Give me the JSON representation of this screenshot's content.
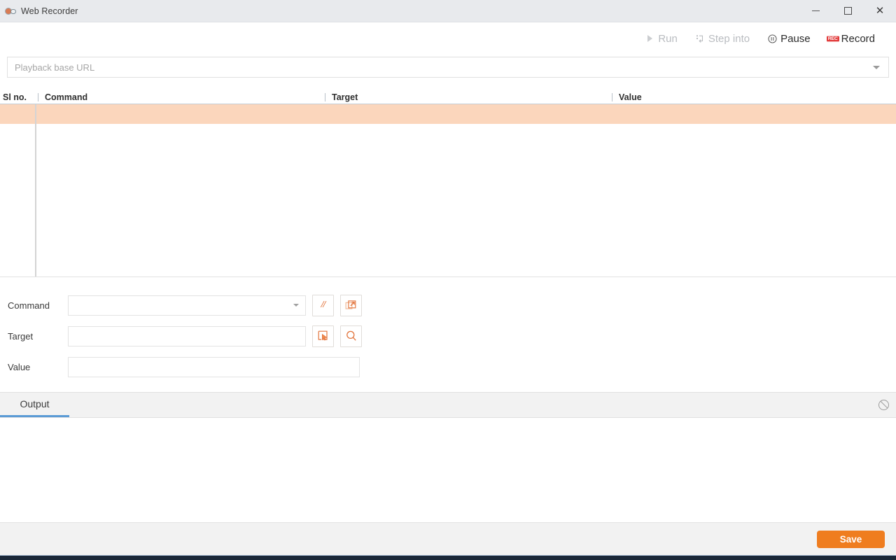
{
  "window": {
    "title": "Web Recorder",
    "app_icon": "web-recorder-icon",
    "controls": {
      "minimize": "minimize-icon",
      "maximize": "maximize-icon",
      "close": "close-icon"
    }
  },
  "toolbar": {
    "buttons": [
      {
        "label": "Run",
        "icon": "play-icon",
        "state": "disabled"
      },
      {
        "label": "Step into",
        "icon": "step-into-icon",
        "state": "disabled"
      },
      {
        "label": "Pause",
        "icon": "pause-icon",
        "state": "enabled"
      },
      {
        "label": "Record",
        "icon": "record-icon",
        "state": "enabled"
      }
    ]
  },
  "url_bar": {
    "placeholder": "Playback base URL",
    "value": "",
    "dropdown_icon": "chevron-down-icon"
  },
  "table": {
    "columns": [
      "Sl no.",
      "Command",
      "Target",
      "Value"
    ],
    "rows": [
      {
        "slno": "",
        "command": "",
        "target": "",
        "value": "",
        "selected": true
      }
    ],
    "selected_row_color": "#fbd6bc"
  },
  "editor": {
    "command": {
      "label": "Command",
      "value": "",
      "placeholder": "",
      "dropdown_icon": "chevron-down-icon",
      "buttons": [
        {
          "icon": "comment-icon",
          "glyph": "//"
        },
        {
          "icon": "open-external-icon"
        }
      ]
    },
    "target": {
      "label": "Target",
      "value": "",
      "placeholder": "",
      "buttons": [
        {
          "icon": "select-element-icon"
        },
        {
          "icon": "find-element-icon"
        }
      ]
    },
    "value": {
      "label": "Value",
      "value": "",
      "placeholder": ""
    }
  },
  "output": {
    "tabs": [
      {
        "label": "Output",
        "active": true
      }
    ],
    "clear_icon": "clear-icon",
    "lines": []
  },
  "footer": {
    "save_label": "Save"
  },
  "colors": {
    "accent_orange": "#ef7d1f",
    "row_highlight": "#fbd6bc",
    "tab_underline": "#5b9bd5",
    "record_red": "#e23b3b"
  }
}
